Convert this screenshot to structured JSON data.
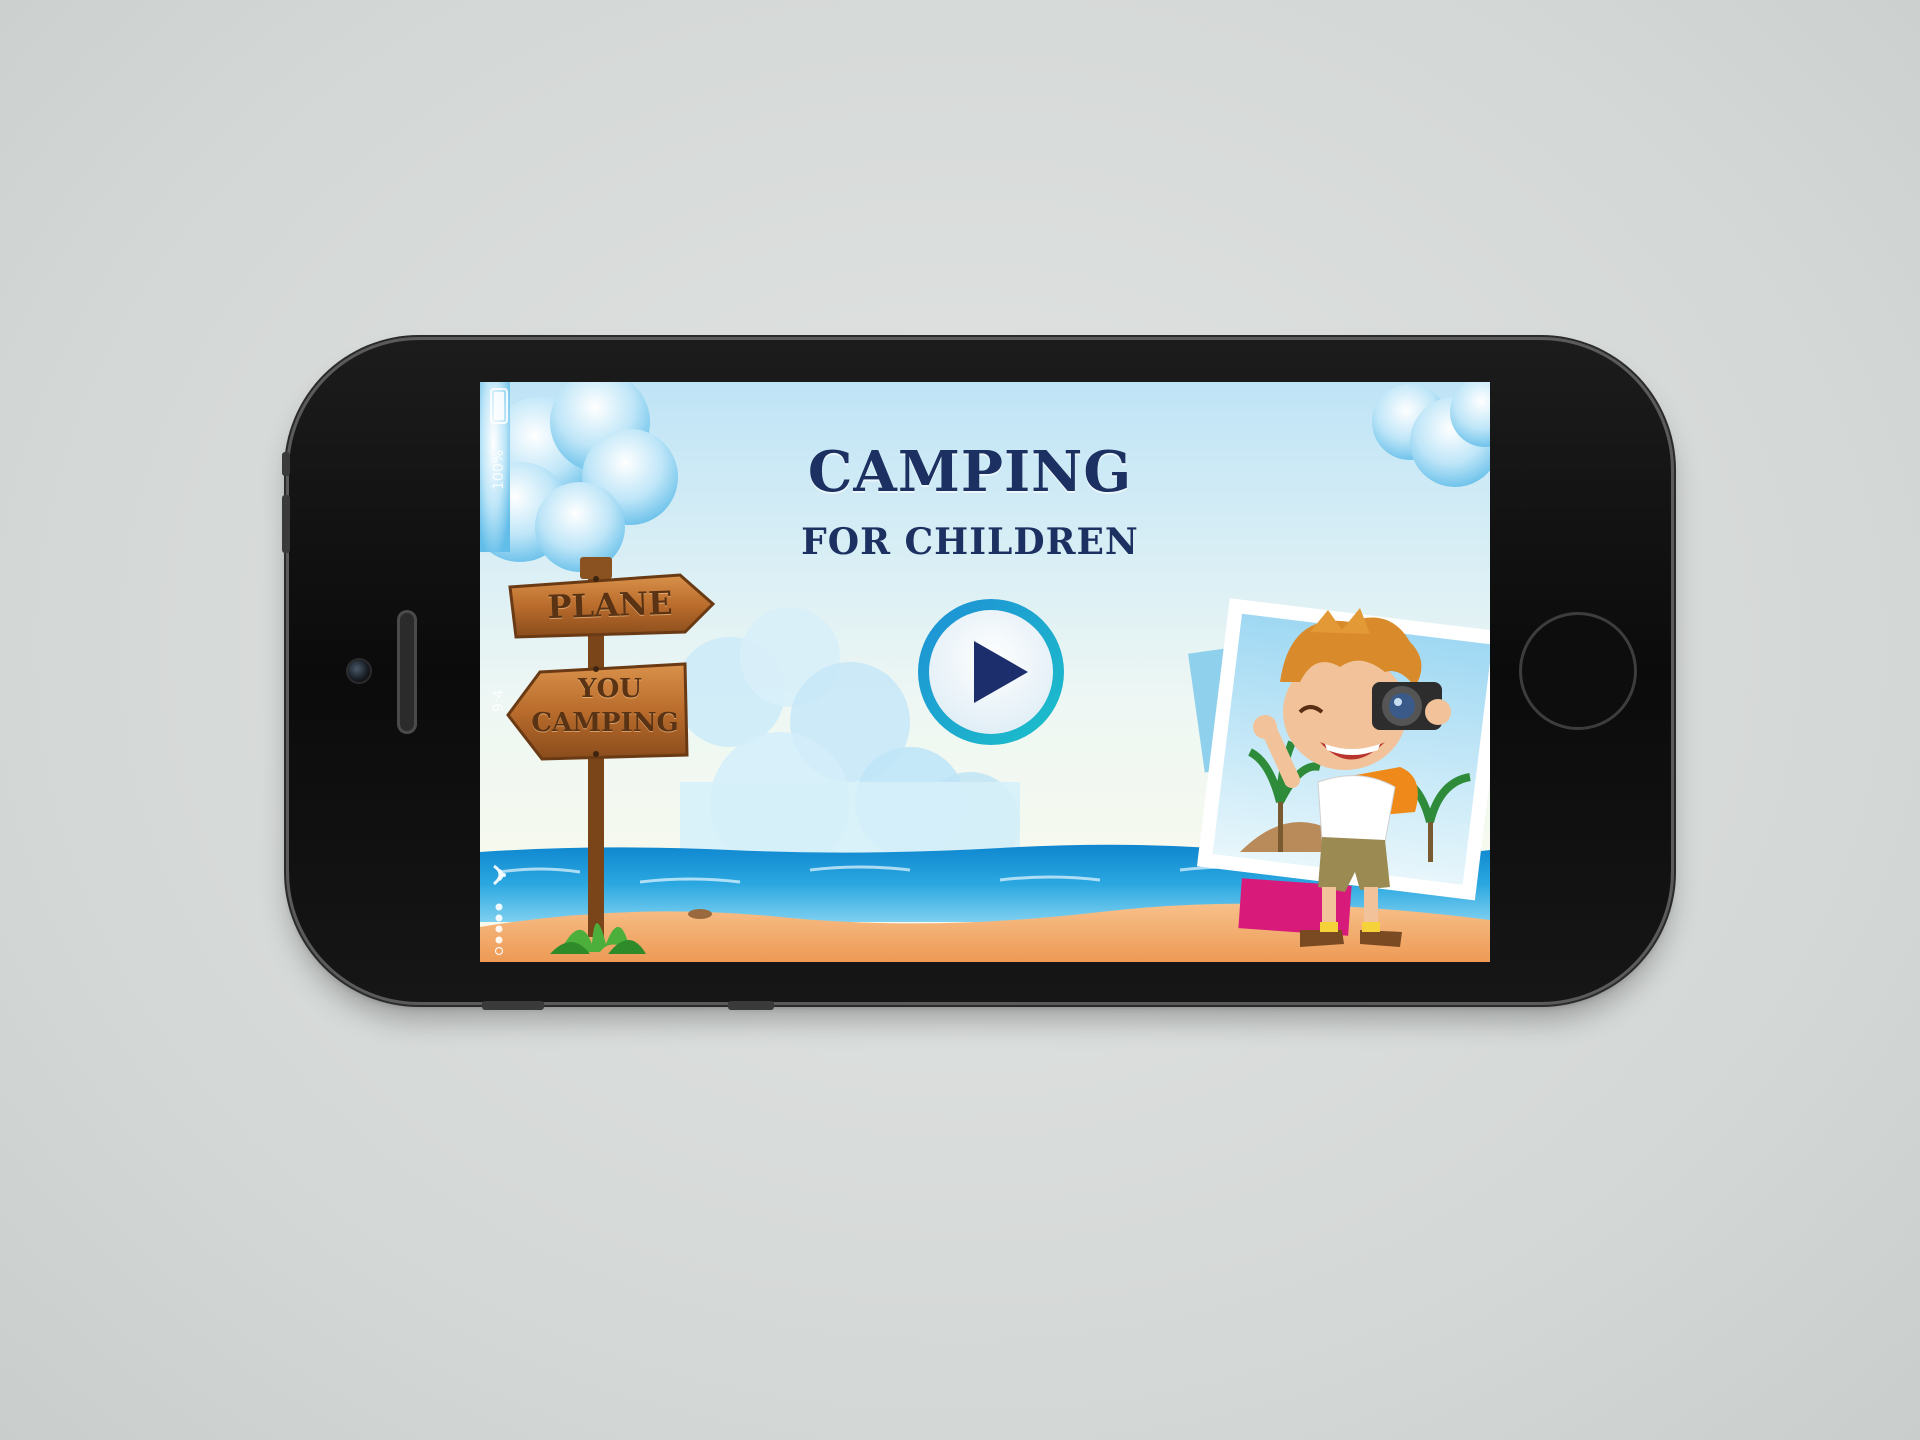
{
  "app": {
    "title": "CAMPING",
    "subtitle": "FOR CHILDREN",
    "signs": {
      "top": "PLANE",
      "bottom_line1": "YOU",
      "bottom_line2": "CAMPING"
    },
    "play_icon": "play-icon"
  },
  "status_bar": {
    "battery": "100%",
    "time": "9:4"
  },
  "colors": {
    "title": "#1c3061",
    "play_ring": "#1aa3d9",
    "play_triangle": "#1c2e6b",
    "sky_top": "#bfe4f6",
    "sea": "#2aa7e0",
    "sand": "#f2a866",
    "phone_body": "#111111",
    "background": "#d9dcda"
  }
}
